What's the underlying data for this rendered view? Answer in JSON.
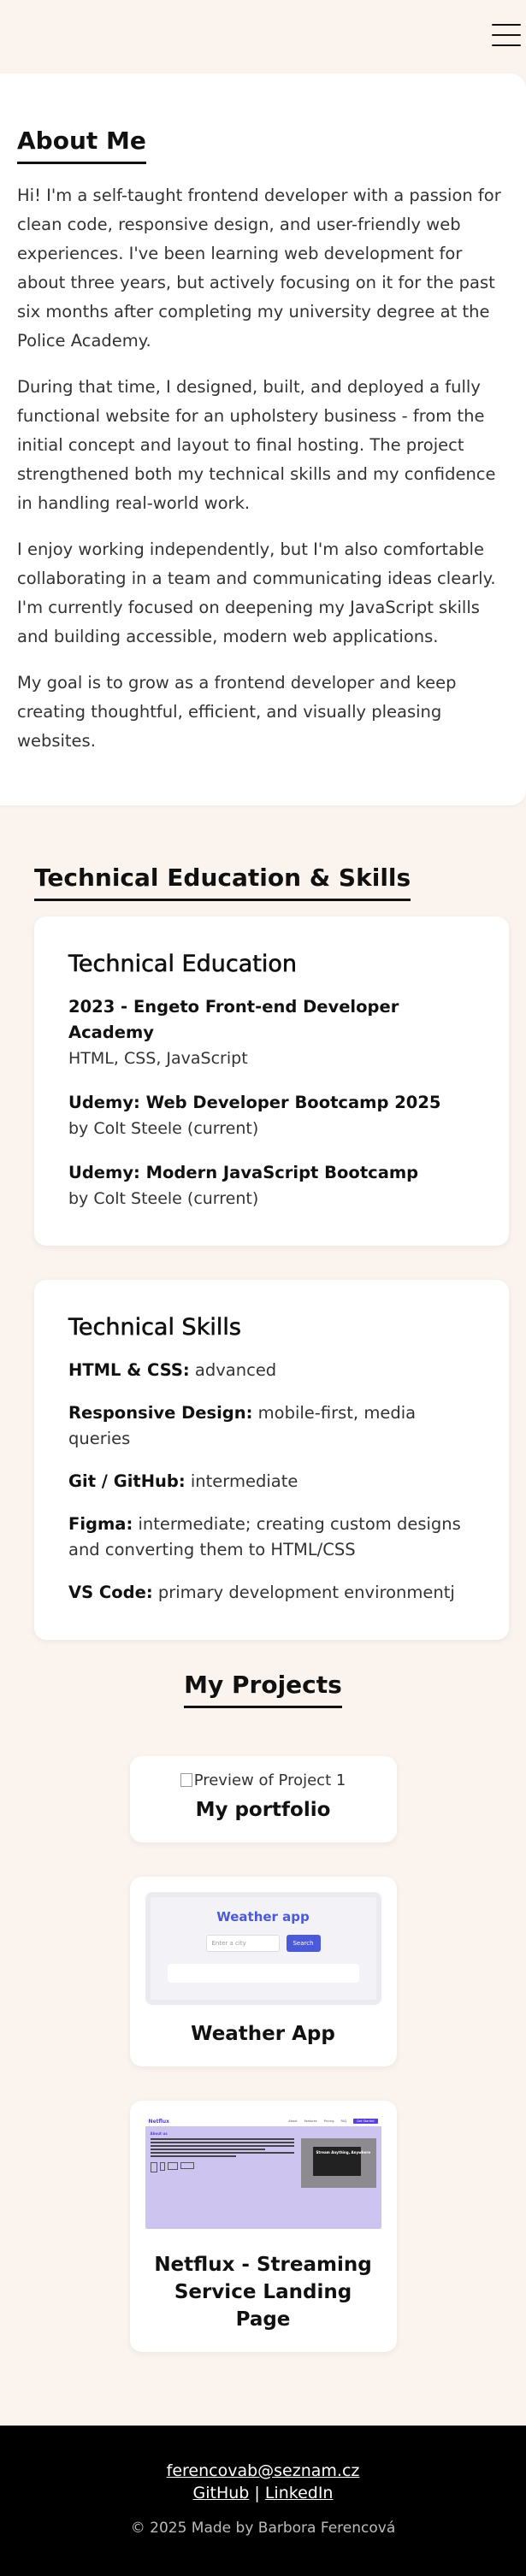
{
  "about": {
    "title": "About Me",
    "paragraphs": [
      "Hi! I'm a self-taught frontend developer with a passion for clean code, responsive design, and user-friendly web experiences. I've been learning web development for about three years, but actively focusing on it for the past six months after completing my university degree at the Police Academy.",
      "During that time, I designed, built, and deployed a fully functional website for an upholstery business - from the initial concept and layout to final hosting. The project strengthened both my technical skills and my confidence in handling real-world work.",
      "I enjoy working independently, but I'm also comfortable collaborating in a team and communicating ideas clearly. I'm currently focused on deepening my JavaScript skills and building accessible, modern web applications.",
      "My goal is to grow as a frontend developer and keep creating thoughtful, efficient, and visually pleasing websites."
    ]
  },
  "skills_section": {
    "title": "Technical Education & Skills",
    "education": {
      "title": "Technical Education",
      "items": [
        {
          "title": "2023 - Engeto Front-end Developer Academy",
          "sub": "HTML, CSS, JavaScript"
        },
        {
          "title": "Udemy: Web Developer Bootcamp 2025",
          "sub": "by Colt Steele (current)"
        },
        {
          "title": "Udemy: Modern JavaScript Bootcamp",
          "sub": "by Colt Steele (current)"
        }
      ]
    },
    "skills": {
      "title": "Technical Skills",
      "items": [
        {
          "name": "HTML & CSS:",
          "value": " advanced"
        },
        {
          "name": "Responsive Design:",
          "value": " mobile-first, media queries"
        },
        {
          "name": "Git / GitHub:",
          "value": " intermediate"
        },
        {
          "name": "Figma:",
          "value": " intermediate; creating custom designs and converting them to HTML/CSS"
        },
        {
          "name": "VS Code:",
          "value": " primary development environmentj"
        }
      ]
    }
  },
  "projects": {
    "title": "My Projects",
    "items": [
      {
        "title": "My portfolio",
        "image_alt": "Preview of Project 1"
      },
      {
        "title": "Weather App",
        "preview": {
          "heading": "Weather app",
          "placeholder": "Enter a city",
          "button": "Search"
        }
      },
      {
        "title": "Netflux - Streaming Service Landing Page",
        "preview": {
          "logo": "Netflux",
          "nav": [
            "About",
            "Features",
            "Pricing",
            "FAQ"
          ],
          "cta": "Get Started",
          "heading": "About us",
          "hero_text": "Stream Anything, Anywhere"
        }
      }
    ]
  },
  "footer": {
    "email": "ferencovab@seznam.cz",
    "github": "GitHub",
    "separator": "|",
    "linkedin": "LinkedIn",
    "copyright": "© 2025 Made by Barbora Ferencová"
  }
}
